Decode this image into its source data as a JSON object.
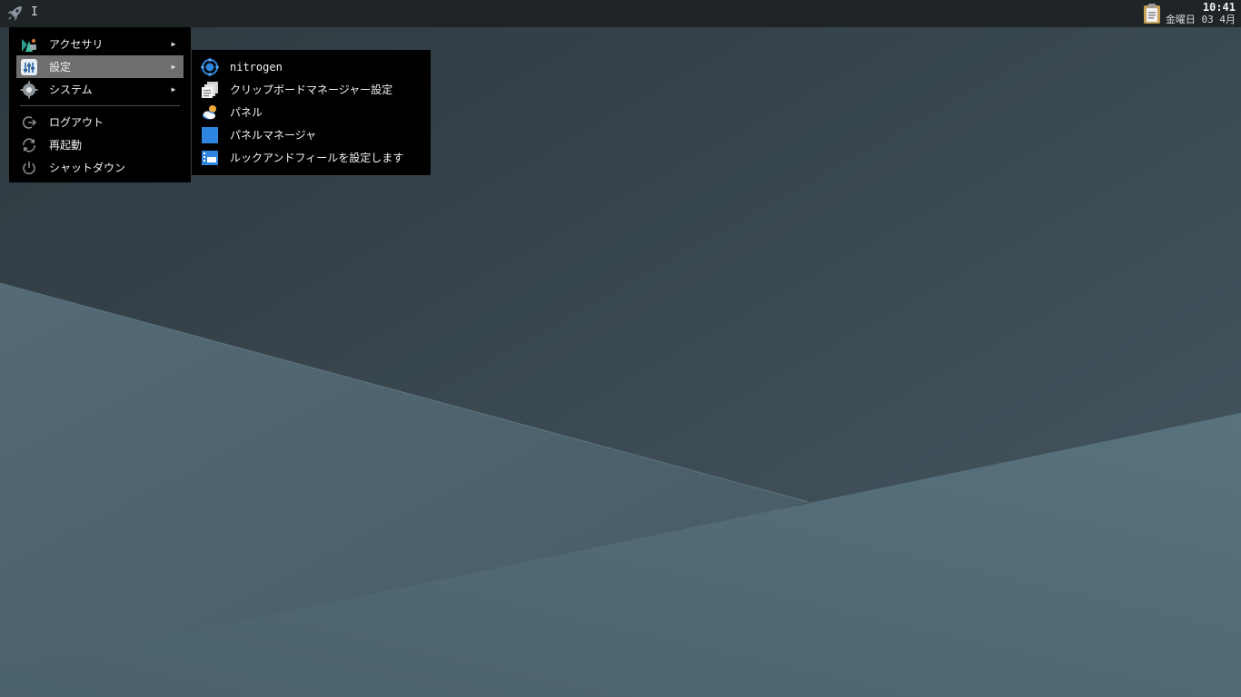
{
  "panel": {
    "launcher_icon": "rocket-icon",
    "cursor_glyph": "I",
    "tray_icon": "clipboard-icon",
    "clock": {
      "time": "10:41",
      "date": "金曜日 03 4月"
    }
  },
  "main_menu": {
    "items": [
      {
        "label": "アクセサリ",
        "icon": "accessories-icon",
        "has_submenu": true
      },
      {
        "label": "設定",
        "icon": "settings-icon",
        "has_submenu": true,
        "active": true
      },
      {
        "label": "システム",
        "icon": "system-gear-icon",
        "has_submenu": true
      }
    ],
    "session_items": [
      {
        "label": "ログアウト",
        "icon": "logout-icon"
      },
      {
        "label": "再起動",
        "icon": "restart-icon"
      },
      {
        "label": "シャットダウン",
        "icon": "power-icon"
      }
    ],
    "submenu_arrow": "▶"
  },
  "settings_submenu": {
    "items": [
      {
        "label": "nitrogen",
        "icon": "nitrogen-icon"
      },
      {
        "label": "クリップボードマネージャー設定",
        "icon": "clipboard-manager-icon"
      },
      {
        "label": "パネル",
        "icon": "panel-weather-icon"
      },
      {
        "label": "パネルマネージャ",
        "icon": "panel-manager-icon"
      },
      {
        "label": "ルックアンドフィールを設定します",
        "icon": "look-and-feel-icon"
      }
    ]
  },
  "colors": {
    "panel_bg": "#1f2427",
    "menu_bg": "#000000",
    "active_item_bg": "#6e6e6e",
    "accent_blue": "#2f86e0"
  }
}
